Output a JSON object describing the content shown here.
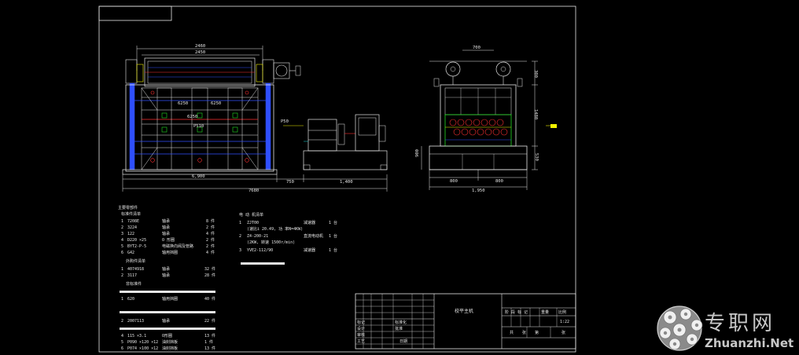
{
  "front_view": {
    "dims_top": [
      "2460",
      "2450"
    ],
    "dims_inner": [
      "6250",
      "6250",
      "6250"
    ],
    "dim_mid": "6250",
    "dim_center": "P510",
    "dim_side": "P50",
    "dims_bottom": [
      "6,900",
      "750",
      "1,400",
      "7680"
    ]
  },
  "side_view": {
    "dim_top": "700",
    "dims_right": [
      "300",
      "1480",
      "530"
    ],
    "dim_left": "900",
    "dims_bottom": [
      "800",
      "800",
      "1,950"
    ]
  },
  "parts_list": {
    "group1_title": "主要零部件",
    "group1_sub": "标准件清单",
    "group1_rows": [
      {
        "no": "1",
        "code": "7208E",
        "desc": "轴承",
        "qty": "8 件"
      },
      {
        "no": "2",
        "code": "3224",
        "desc": "轴承",
        "qty": "2 件"
      },
      {
        "no": "3",
        "code": "122",
        "desc": "轴承",
        "qty": "4 件"
      },
      {
        "no": "4",
        "code": "D220 ×25",
        "desc": "O 形圈",
        "qty": "2 件"
      },
      {
        "no": "5",
        "code": "BYT2-P-5",
        "desc": "电磁换向阀及管路",
        "qty": "2 件"
      },
      {
        "no": "6",
        "code": "G42",
        "desc": "轴用挡圈",
        "qty": "4 件"
      }
    ],
    "group2_title": "外购件清单",
    "group2_rows": [
      {
        "no": "1",
        "code": "4074918",
        "desc": "轴承",
        "qty": "32 件"
      },
      {
        "no": "2",
        "code": "3117",
        "desc": "轴承",
        "qty": "28 件"
      }
    ],
    "group3_title": "非标准件",
    "group3_rows": [
      {
        "no": "1",
        "code": "620",
        "desc": "轴用挡圈",
        "qty": "40 件"
      }
    ],
    "group4_rows": [
      {
        "no": "2",
        "code": "2007113",
        "desc": "轴承",
        "qty": "22 件"
      }
    ],
    "group5_rows": [
      {
        "no": "4",
        "code": "115 ×3.1",
        "desc": "O形圈",
        "qty": "13 件"
      },
      {
        "no": "5",
        "code": "P090 ×120 ×12",
        "desc": "油封挡板",
        "qty": "1 件"
      },
      {
        "no": "6",
        "code": "P074 ×100 ×12",
        "desc": "油封挡板",
        "qty": "13 件"
      }
    ]
  },
  "motor_list": {
    "title": "电 动 机清单",
    "rows": [
      {
        "no": "1",
        "code": "ZJT00",
        "desc": "减速器",
        "qty": "1 台"
      },
      {
        "no": "",
        "code": "(速比i 20.49, 功 率N=4KW)",
        "desc": "",
        "qty": ""
      },
      {
        "no": "2",
        "code": "Z4-200-21",
        "desc": "直流电动机",
        "qty": "1 台"
      },
      {
        "no": "",
        "code": "(2KW,  转速 1500r/min)",
        "desc": "",
        "qty": ""
      },
      {
        "no": "3",
        "code": "YVE2-112/90",
        "desc": "减速器",
        "qty": "1 台"
      }
    ]
  },
  "title_block": {
    "drawing_name": "校平主机",
    "scale": "1:22",
    "left_labels": [
      "标记",
      "设计",
      "审核",
      "工艺"
    ],
    "mid_labels": [
      "标准化",
      "批准"
    ],
    "date_label": "日期",
    "right_labels": [
      "阶 段 标 记",
      "重量",
      "比例"
    ],
    "sheet_labels": [
      "共",
      "张",
      "第",
      "张"
    ]
  },
  "watermark": {
    "cn": "专职网",
    "en": "Zhuanzhi.Net"
  },
  "colors": {
    "background": "#000000",
    "line": "#e6e6e6",
    "blue": "#2f4fff",
    "green": "#22dd22",
    "red": "#ff3030",
    "yellow": "#f2f200",
    "cyan": "#22dddd"
  }
}
